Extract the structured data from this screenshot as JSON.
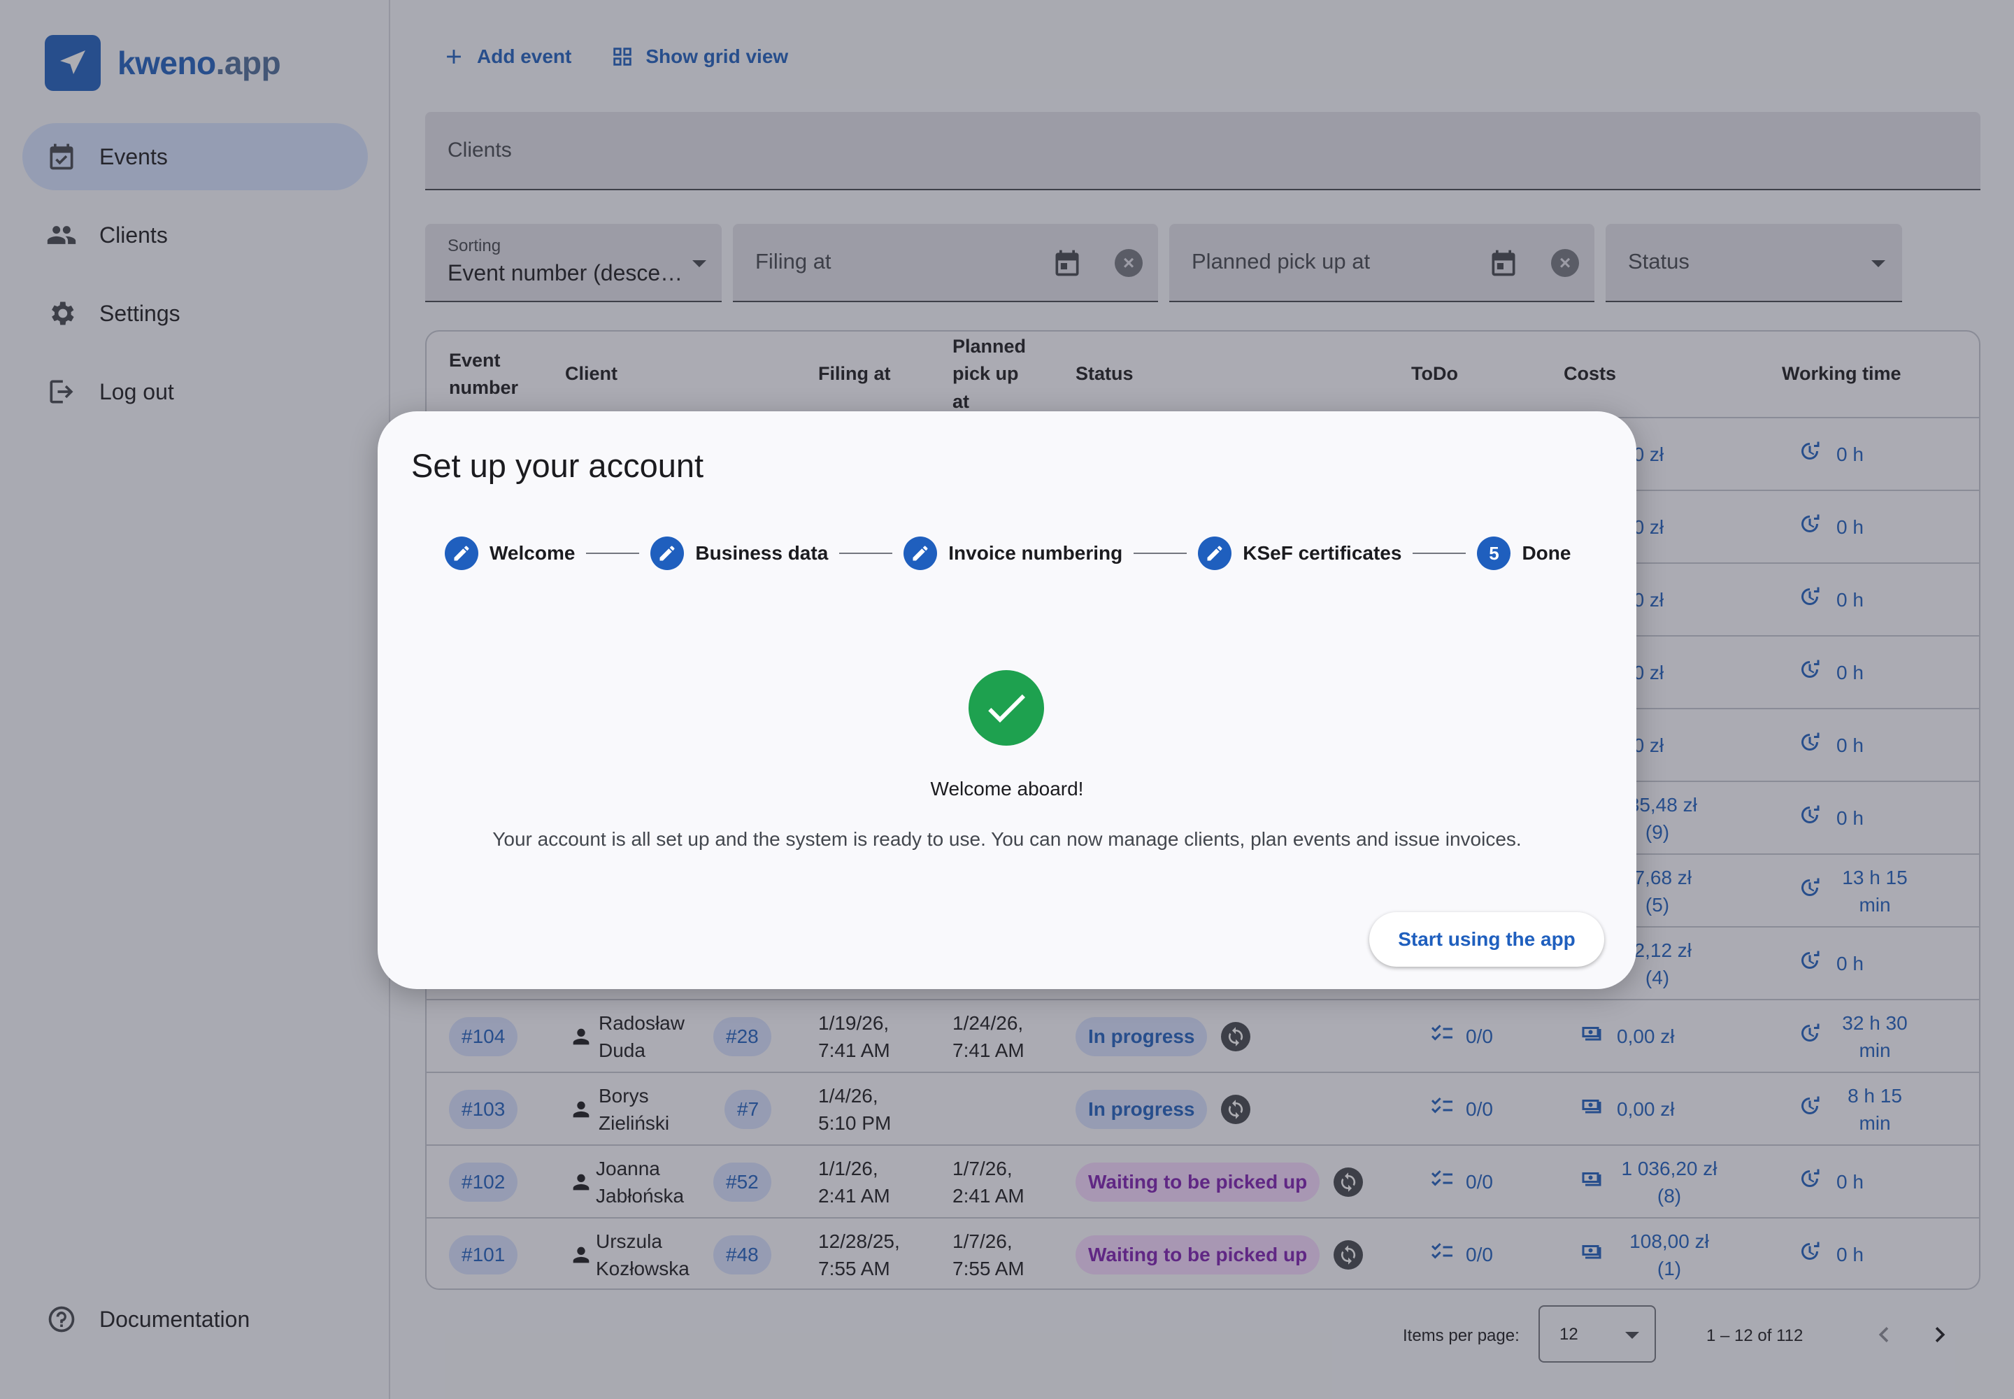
{
  "app": {
    "brand": "kweno",
    "brand_suffix": ".app",
    "accent_color": "#1f5fbe"
  },
  "sidebar": {
    "items": [
      {
        "label": "Events",
        "icon": "calendar-check-icon",
        "active": true
      },
      {
        "label": "Clients",
        "icon": "people-icon"
      },
      {
        "label": "Settings",
        "icon": "gear-icon"
      },
      {
        "label": "Log out",
        "icon": "logout-icon"
      }
    ],
    "footer_item": {
      "label": "Documentation",
      "icon": "help-circle-icon"
    }
  },
  "toolbar": {
    "add_event": "Add event",
    "grid_view": "Show grid view"
  },
  "filters": {
    "clients_placeholder": "Clients",
    "sorting_label": "Sorting",
    "sorting_value": "Event number (desce…",
    "filing_placeholder": "Filing at",
    "pickup_placeholder": "Planned pick up at",
    "status_placeholder": "Status"
  },
  "table": {
    "headers": {
      "event_number": "Event number",
      "client": "Client",
      "filing_at": "Filing at",
      "planned_pickup": "Planned pick up at",
      "status": "Status",
      "todo": "ToDo",
      "costs": "Costs",
      "working_time": "Working time"
    },
    "hidden_rows": [
      {
        "costs": "00 zł",
        "working_time": "0 h"
      },
      {
        "costs": "00 zł",
        "working_time": "0 h"
      },
      {
        "costs": "00 zł",
        "working_time": "0 h"
      },
      {
        "costs": "00 zł",
        "working_time": "0 h"
      },
      {
        "costs": "00 zł",
        "working_time": "0 h"
      },
      {
        "costs": "035,48 zł (9)",
        "working_time": "0 h"
      },
      {
        "costs": "67,68 zł (5)",
        "working_time": "13 h 15 min"
      },
      {
        "costs": "12,12 zł (4)",
        "working_time": "0 h"
      }
    ],
    "rows": [
      {
        "event": "#104",
        "client": "Radosław Duda",
        "client_id": "#28",
        "filing": "1/19/26, 7:41 AM",
        "pickup": "1/24/26, 7:41 AM",
        "status": "In progress",
        "status_type": "progress",
        "todo": "0/0",
        "costs": "0,00 zł",
        "working_time": "32 h 30 min"
      },
      {
        "event": "#103",
        "client": "Borys Zieliński",
        "client_id": "#7",
        "filing": "1/4/26, 5:10 PM",
        "pickup": "",
        "status": "In progress",
        "status_type": "progress",
        "todo": "0/0",
        "costs": "0,00 zł",
        "working_time": "8 h 15 min"
      },
      {
        "event": "#102",
        "client": "Joanna Jabłońska",
        "client_id": "#52",
        "filing": "1/1/26, 2:41 AM",
        "pickup": "1/7/26, 2:41 AM",
        "status": "Waiting to be picked up",
        "status_type": "waiting",
        "todo": "0/0",
        "costs": "1 036,20 zł (8)",
        "working_time": "0 h"
      },
      {
        "event": "#101",
        "client": "Urszula Kozłowska",
        "client_id": "#48",
        "filing": "12/28/25, 7:55 AM",
        "pickup": "1/7/26, 7:55 AM",
        "status": "Waiting to be picked up",
        "status_type": "waiting",
        "todo": "0/0",
        "costs": "108,00 zł (1)",
        "working_time": "0 h"
      }
    ]
  },
  "pagination": {
    "label": "Items per page:",
    "per_page": "12",
    "range": "1 – 12 of 112"
  },
  "dialog": {
    "title": "Set up your account",
    "steps": [
      {
        "label": "Welcome",
        "state": "edit"
      },
      {
        "label": "Business data",
        "state": "edit"
      },
      {
        "label": "Invoice numbering",
        "state": "edit"
      },
      {
        "label": "KSeF certificates",
        "state": "edit"
      },
      {
        "label": "Done",
        "state": "current",
        "number": "5"
      }
    ],
    "success_heading": "Welcome aboard!",
    "description": "Your account is all set up and the system is ready to use. You can now manage clients, plan events and issue invoices.",
    "button": "Start using the app",
    "success_color": "#1ea14f"
  }
}
